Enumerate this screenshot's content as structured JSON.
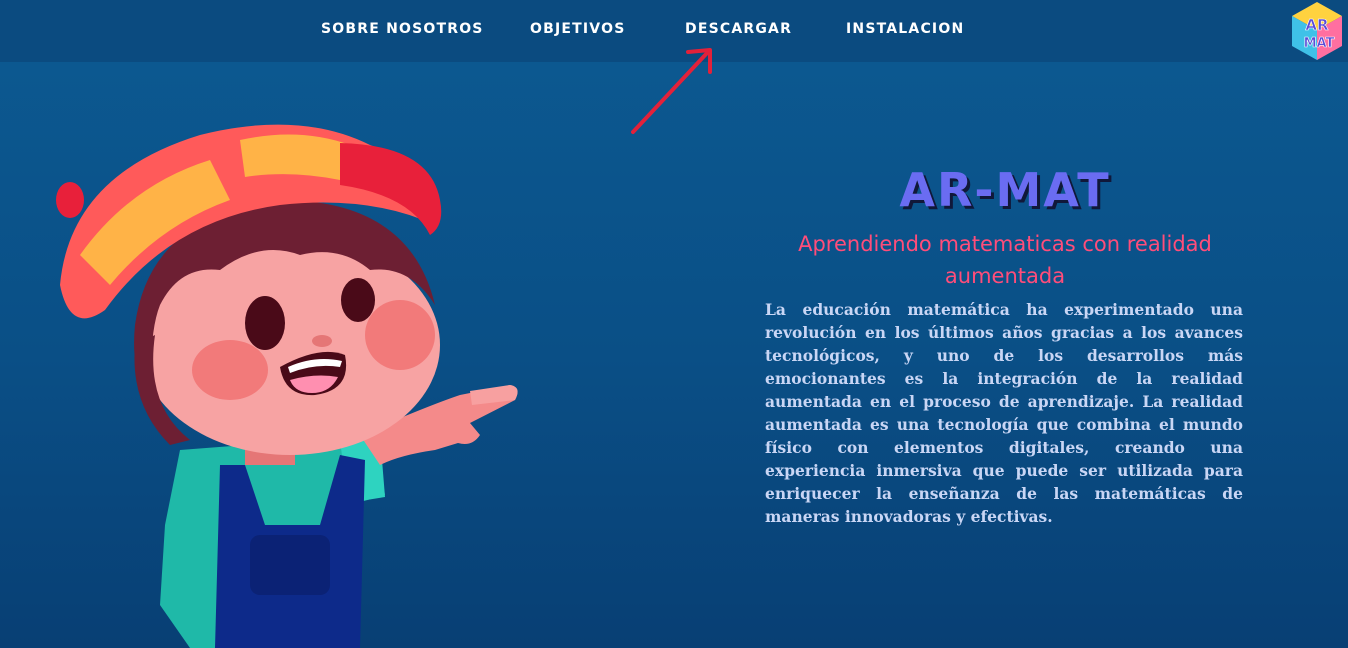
{
  "nav": {
    "items": [
      {
        "label": "SOBRE NOSOTROS"
      },
      {
        "label": "OBJETIVOS"
      },
      {
        "label": "DESCARGAR"
      },
      {
        "label": "INSTALACION"
      }
    ],
    "logo_text": "AR MAT"
  },
  "hero": {
    "title": "AR-MAT",
    "subtitle": "Aprendiendo matematicas con realidad aumentada",
    "body": "La educación matemática ha experimentado una revolución en los últimos años gracias a los avances tecnológicos, y uno de los desarrollos más emocionantes es la integración de la realidad aumentada en el proceso de aprendizaje. La realidad aumentada es una tecnología que combina el mundo físico con elementos digitales, creando una experiencia inmersiva que puede ser utilizada para enriquecer la enseñanza de las matemáticas de maneras innovadoras y efectivas."
  },
  "colors": {
    "background": "#0a4f86",
    "navbar": "#0b4b80",
    "title": "#6a6cf2",
    "subtitle": "#ff4d7a",
    "body_text": "#c9d6f5",
    "arrow": "#e3213a"
  },
  "icons": {
    "logo": "ar-mat-cube-logo",
    "arrow": "red-arrow-pointer",
    "illustration": "cartoon-boy-pointing"
  }
}
